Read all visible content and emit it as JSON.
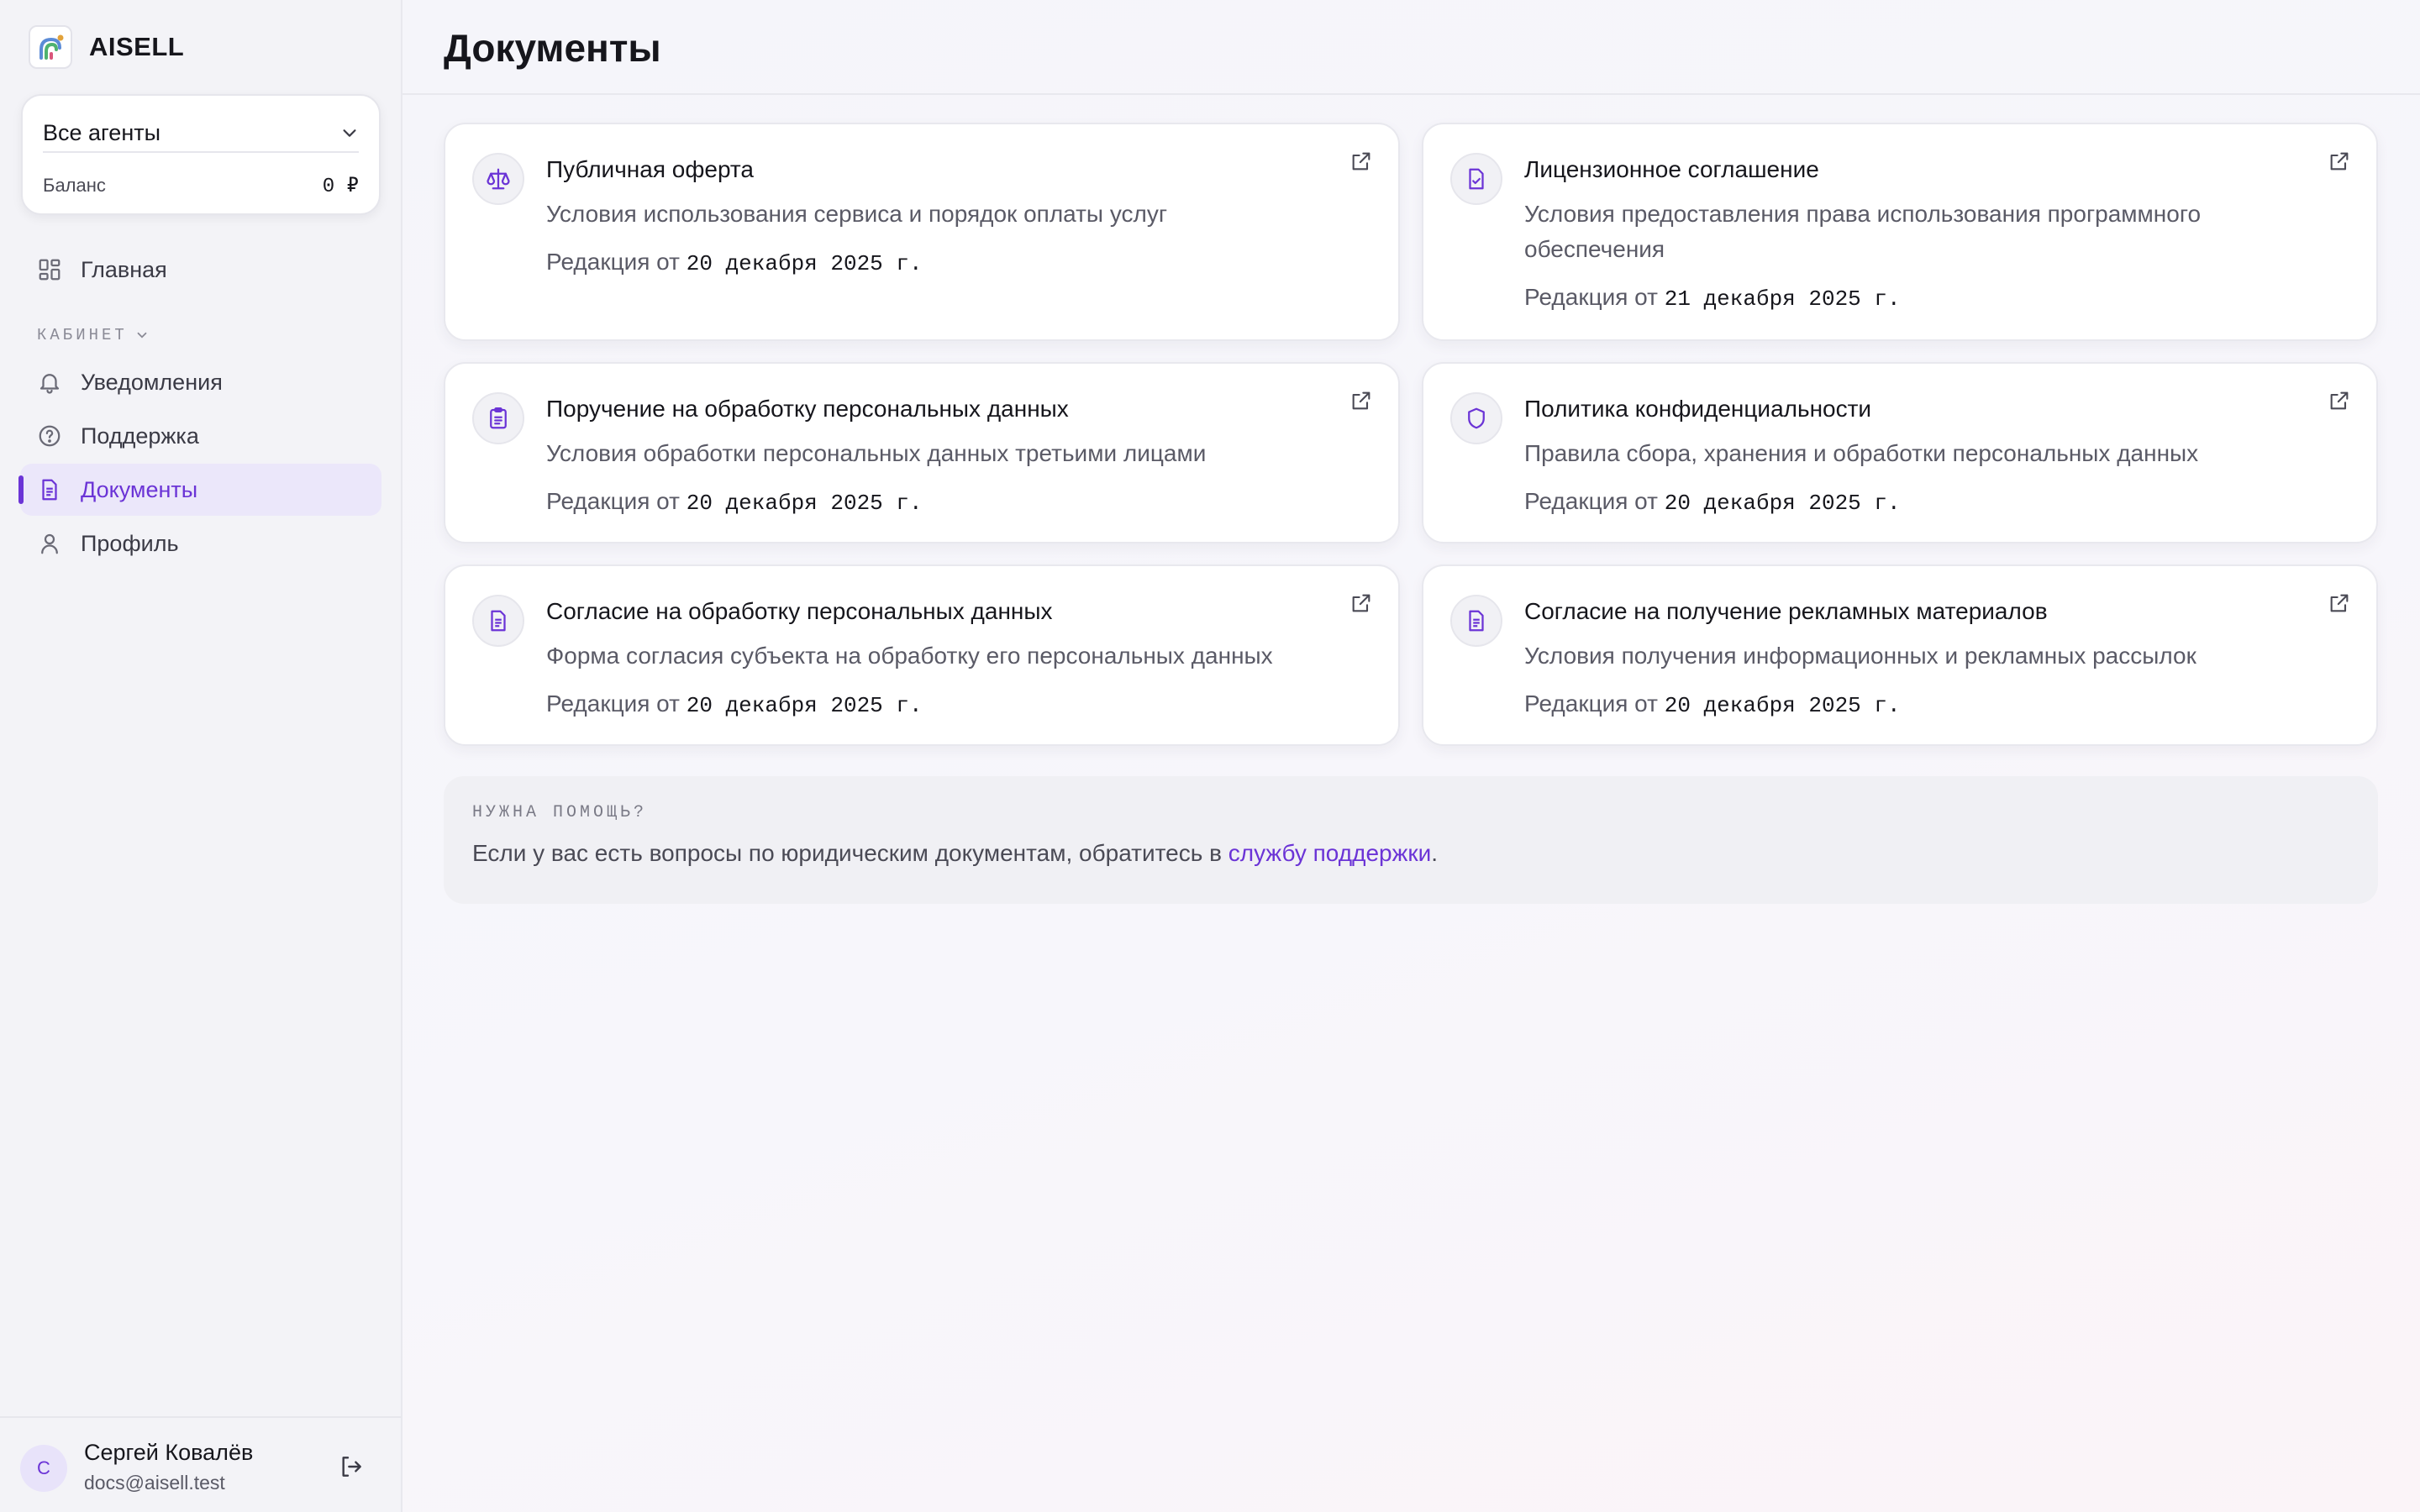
{
  "brand": {
    "name": "AISELL"
  },
  "agent_selector": {
    "label": "Все агенты",
    "balance_label": "Баланс",
    "balance_value": "0 ₽"
  },
  "nav": {
    "home": "Главная",
    "section": "КАБИНЕТ",
    "notifications": "Уведомления",
    "support": "Поддержка",
    "documents": "Документы",
    "profile": "Профиль"
  },
  "user": {
    "name": "Сергей Ковалёв",
    "email": "docs@aisell.test",
    "initial": "С"
  },
  "page": {
    "title": "Документы"
  },
  "documents": [
    {
      "title": "Публичная оферта",
      "description": "Условия использования сервиса и порядок оплаты услуг",
      "date_prefix": "Редакция от",
      "date": "20 декабря 2025 г.",
      "icon": "scale-icon"
    },
    {
      "title": "Лицензионное соглашение",
      "description": "Условия предоставления права использования программного обеспечения",
      "date_prefix": "Редакция от",
      "date": "21 декабря 2025 г.",
      "icon": "file-check-icon"
    },
    {
      "title": "Поручение на обработку персональных данных",
      "description": "Условия обработки персональных данных третьими лицами",
      "date_prefix": "Редакция от",
      "date": "20 декабря 2025 г.",
      "icon": "clipboard-icon"
    },
    {
      "title": "Политика конфиденциальности",
      "description": "Правила сбора, хранения и обработки персональных данных",
      "date_prefix": "Редакция от",
      "date": "20 декабря 2025 г.",
      "icon": "shield-icon"
    },
    {
      "title": "Согласие на обработку персональных данных",
      "description": "Форма согласия субъекта на обработку его персональных данных",
      "date_prefix": "Редакция от",
      "date": "20 декабря 2025 г.",
      "icon": "document-icon"
    },
    {
      "title": "Согласие на получение рекламных материалов",
      "description": "Условия получения информационных и рекламных рассылок",
      "date_prefix": "Редакция от",
      "date": "20 декабря 2025 г.",
      "icon": "document-icon"
    }
  ],
  "help": {
    "label": "НУЖНА ПОМОЩЬ?",
    "text": "Если у вас есть вопросы по юридическим документам, обратитесь в",
    "link": "службу поддержки",
    "suffix": "."
  },
  "colors": {
    "accent": "#6b34d6",
    "active_bg": "#ebe7fa",
    "sidebar_bg": "#f3f3f7"
  }
}
